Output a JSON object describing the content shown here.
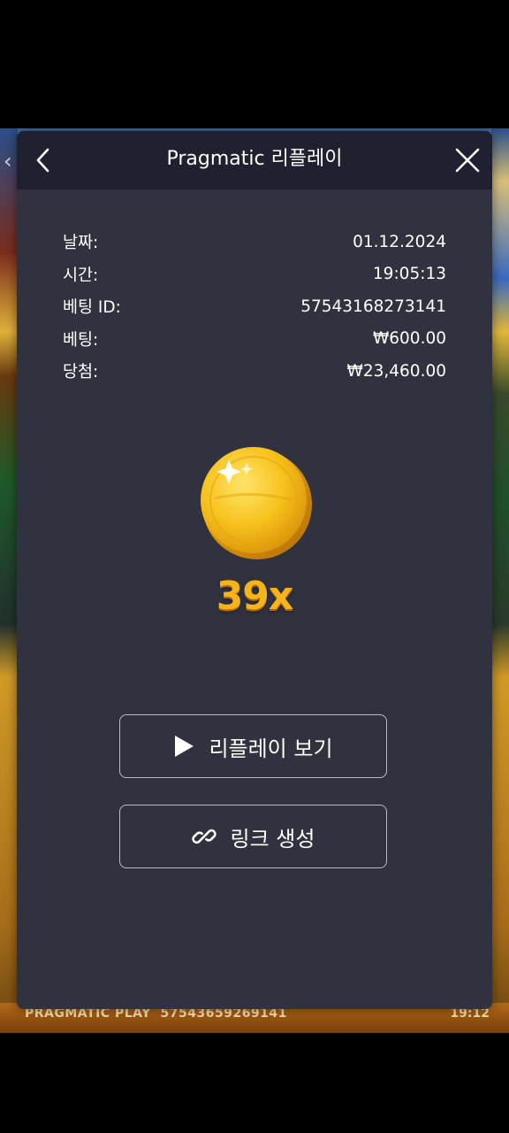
{
  "background": {
    "footer_brand": "PRAGMATIC PLAY",
    "footer_id": "57543659269141",
    "footer_time": "19:12"
  },
  "modal": {
    "title": "Pragmatic 리플레이",
    "back_icon": "chevron-left-icon",
    "close_icon": "close-icon"
  },
  "info": [
    {
      "label": "날짜:",
      "value": "01.12.2024"
    },
    {
      "label": "시간:",
      "value": "19:05:13"
    },
    {
      "label": "베팅 ID:",
      "value": "57543168273141"
    },
    {
      "label": "베팅:",
      "value": "₩600.00"
    },
    {
      "label": "당첨:",
      "value": "₩23,460.00"
    }
  ],
  "win": {
    "icon": "gold-coin-icon",
    "multiplier": "39x"
  },
  "actions": {
    "replay_label": "리플레이 보기",
    "replay_icon": "play-icon",
    "link_label": "링크 생성",
    "link_icon": "link-icon"
  },
  "colors": {
    "modal_bg": "#30323f",
    "header_bg": "#1f2130",
    "accent_gold": "#f6b41c"
  }
}
